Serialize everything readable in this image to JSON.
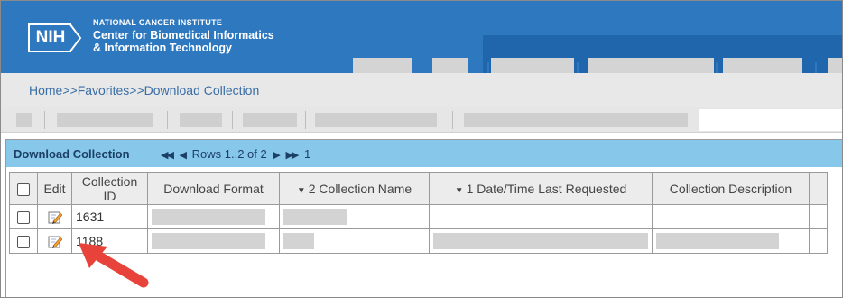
{
  "header": {
    "logo_text": "NIH",
    "org_line1": "NATIONAL CANCER INSTITUTE",
    "org_line2": "Center for Biomedical Informatics",
    "org_line3": "& Information Technology"
  },
  "breadcrumb": "Home>>Favorites>>Download Collection",
  "panel": {
    "title": "Download Collection",
    "pager_text": "Rows 1..2 of 2",
    "page_number": "1"
  },
  "table": {
    "headers": {
      "edit": "Edit",
      "collection_id_line1": "Collection",
      "collection_id_line2": "ID",
      "download_format": "Download Format",
      "collection_name": "2 Collection Name",
      "date_last_requested": "1 Date/Time Last Requested",
      "collection_description": "Collection Description"
    },
    "rows": [
      {
        "id": "1631"
      },
      {
        "id": "1188"
      }
    ]
  },
  "colors": {
    "banner": "#2e78bf",
    "panel_header": "#87c7ea",
    "arrow": "#e8433a"
  }
}
